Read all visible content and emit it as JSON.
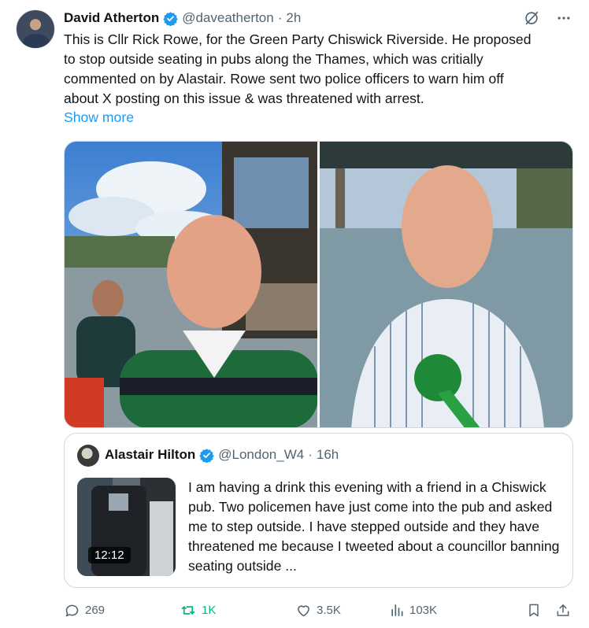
{
  "post": {
    "author_name": "David Atherton",
    "author_handle": "@daveatherton",
    "separator": "·",
    "time": "2h",
    "text": "This is Cllr Rick Rowe, for the Green Party Chiswick Riverside. He proposed\nto stop outside seating in pubs along the Thames, which was critially\ncommented on by Alastair. Rowe sent two police officers to warn him off\nabout X posting on this issue & was threatened with arrest.",
    "show_more": "Show more"
  },
  "quote": {
    "author_name": "Alastair Hilton",
    "author_handle": "@London_W4",
    "separator": "·",
    "time": "16h",
    "video_duration": "12:12",
    "text": "I am having a drink this evening with a friend in a Chiswick pub. Two policemen have just come into the pub and asked me to step outside. I have stepped outside and they have threatened me because I tweeted about a councillor banning seating outside ..."
  },
  "actions": {
    "replies": "269",
    "reposts": "1K",
    "likes": "3.5K",
    "views": "103K"
  },
  "colors": {
    "accent": "#1d9bf0",
    "repost_active": "#00ba7c",
    "secondary_text": "#536471"
  },
  "icons": {
    "verified": "verified-badge-icon",
    "grok": "grok-icon",
    "more": "more-icon",
    "reply": "reply-icon",
    "repost": "repost-icon",
    "like": "heart-icon",
    "views": "views-icon",
    "bookmark": "bookmark-icon",
    "share": "share-icon"
  }
}
